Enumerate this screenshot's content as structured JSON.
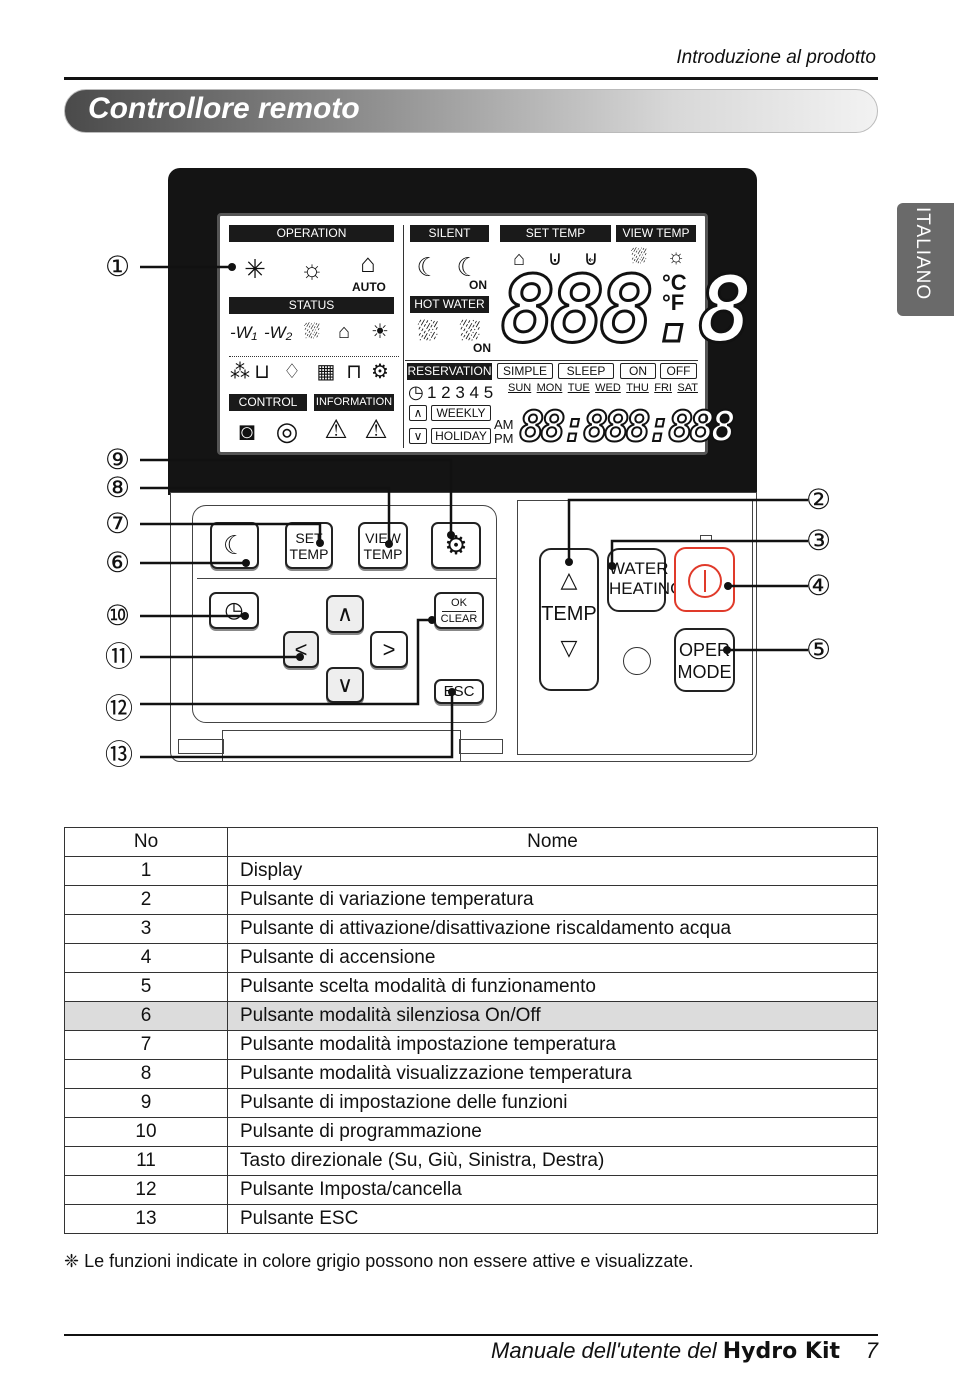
{
  "header": {
    "section": "Introduzione al prodotto",
    "title": "Controllore remoto",
    "side_tab": "ITALIANO"
  },
  "lcd": {
    "operation": "OPERATION",
    "auto": "AUTO",
    "status": "STATUS",
    "silent": "SILENT",
    "on": "ON",
    "hot_water": "HOT WATER",
    "set_temp": "SET TEMP",
    "view_temp": "VIEW TEMP",
    "main_digits": "888.8",
    "celsius": "°C",
    "fahrenheit": "°F",
    "control": "CONTROL",
    "information": "INFORMATION",
    "reservation": "RESERVATION",
    "simple": "SIMPLE",
    "sleep": "SLEEP",
    "res_on": "ON",
    "res_off": "OFF",
    "slots": "1 2 3 4 5",
    "days": [
      "SUN",
      "MON",
      "TUE",
      "WED",
      "THU",
      "FRI",
      "SAT"
    ],
    "weekly": "WEEKLY",
    "holiday": "HOLIDAY",
    "am": "AM",
    "pm": "PM",
    "clock_digits": "88:888:888",
    "w1": "-W₁",
    "w2": "-W₂"
  },
  "buttons": {
    "set_temp": "SET TEMP",
    "view_temp": "VIEW TEMP",
    "ok": "OK",
    "clear": "CLEAR",
    "esc": "ESC",
    "temp": "TEMP",
    "water_heating": "WATER HEATING",
    "oper_mode": "OPER MODE"
  },
  "callouts": [
    "①",
    "②",
    "③",
    "④",
    "⑤",
    "⑥",
    "⑦",
    "⑧",
    "⑨",
    "⑩",
    "⑪",
    "⑫",
    "⑬"
  ],
  "colors": {
    "power_button": "#e03a2a",
    "highlight_row": "#dcdcdc"
  },
  "table": {
    "headers": [
      "No",
      "Nome"
    ],
    "rows": [
      {
        "no": "1",
        "name": "Display"
      },
      {
        "no": "2",
        "name": "Pulsante di variazione temperatura"
      },
      {
        "no": "3",
        "name": "Pulsante di attivazione/disattivazione riscaldamento acqua"
      },
      {
        "no": "4",
        "name": "Pulsante di accensione"
      },
      {
        "no": "5",
        "name": "Pulsante scelta modalità di funzionamento"
      },
      {
        "no": "6",
        "name": "Pulsante modalità silenziosa On/Off"
      },
      {
        "no": "7",
        "name": "Pulsante modalità impostazione temperatura"
      },
      {
        "no": "8",
        "name": "Pulsante modalità visualizzazione temperatura"
      },
      {
        "no": "9",
        "name": "Pulsante di impostazione delle funzioni"
      },
      {
        "no": "10",
        "name": "Pulsante di programmazione"
      },
      {
        "no": "11",
        "name": "Tasto direzionale (Su, Giù, Sinistra, Destra)"
      },
      {
        "no": "12",
        "name": "Pulsante Imposta/cancella"
      },
      {
        "no": "13",
        "name": "Pulsante ESC"
      }
    ]
  },
  "note": "❈ Le funzioni indicate in colore grigio possono non essere attive e visualizzate.",
  "footer": {
    "text": "Manuale dell'utente del",
    "product": "Hydro Kit",
    "page": "7"
  }
}
